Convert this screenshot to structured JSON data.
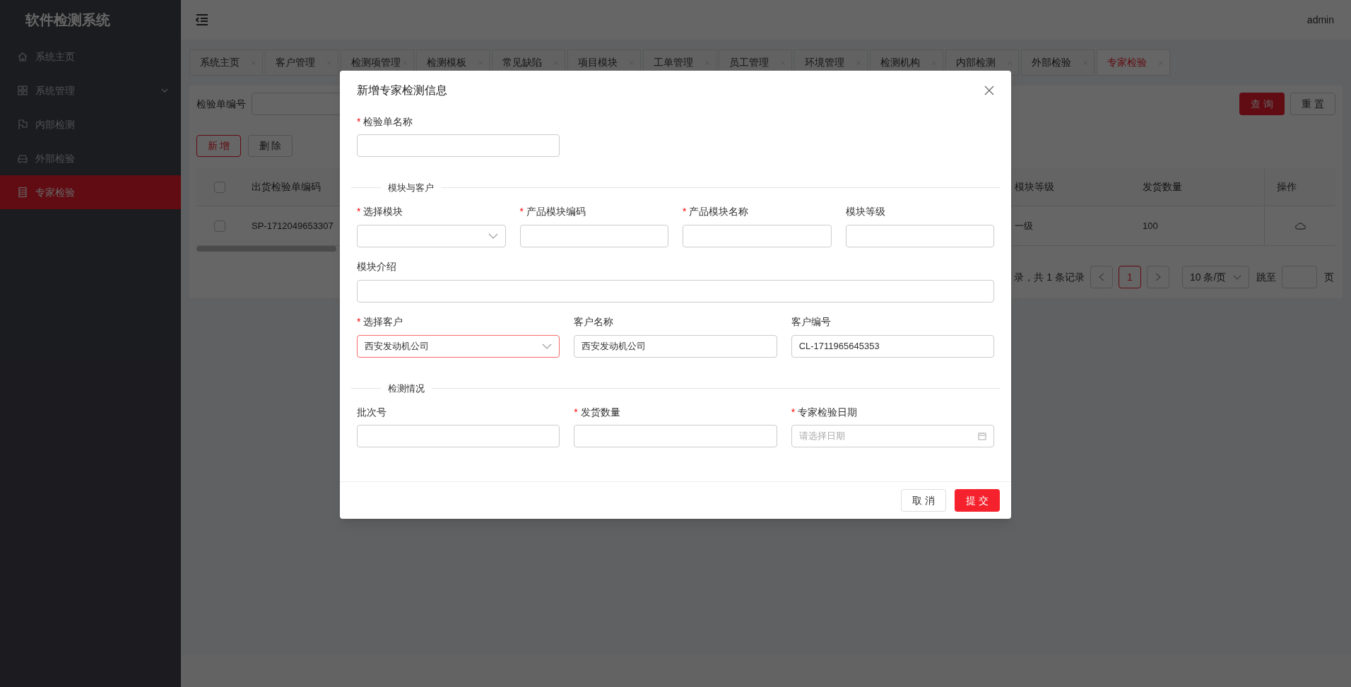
{
  "sidebar": {
    "title": "软件检测系统",
    "items": [
      {
        "label": "系统主页",
        "kind": "home",
        "selected": false,
        "expandable": false
      },
      {
        "label": "系统管理",
        "kind": "grid",
        "selected": false,
        "expandable": true
      },
      {
        "label": "内部检测",
        "kind": "flag",
        "selected": false,
        "expandable": false
      },
      {
        "label": "外部检验",
        "kind": "car",
        "selected": false,
        "expandable": false
      },
      {
        "label": "专家检验",
        "kind": "list",
        "selected": true,
        "expandable": false
      }
    ]
  },
  "header": {
    "user": "admin"
  },
  "tabs": [
    {
      "label": "系统主页",
      "selected": false
    },
    {
      "label": "客户管理",
      "selected": false
    },
    {
      "label": "检测项管理",
      "selected": false
    },
    {
      "label": "检测模板",
      "selected": false
    },
    {
      "label": "常见缺陷",
      "selected": false
    },
    {
      "label": "项目模块",
      "selected": false
    },
    {
      "label": "工单管理",
      "selected": false
    },
    {
      "label": "员工管理",
      "selected": false
    },
    {
      "label": "环境管理",
      "selected": false
    },
    {
      "label": "检测机构",
      "selected": false
    },
    {
      "label": "内部检测",
      "selected": false
    },
    {
      "label": "外部检验",
      "selected": false
    },
    {
      "label": "专家检验",
      "selected": true
    }
  ],
  "search": {
    "label": "检验单编号",
    "query_button": "查 询",
    "reset_button": "重 置"
  },
  "actions": [
    {
      "label": "新 增",
      "kind": "primary"
    },
    {
      "label": "删 除",
      "kind": "plain"
    }
  ],
  "table": {
    "header_checked": false,
    "columns": [
      "出货检验单编码",
      "模块等级",
      "发货数量",
      "操作"
    ],
    "rows": [
      {
        "checked": false,
        "cells": [
          "SP-1712049653307",
          "一级",
          "100"
        ]
      }
    ]
  },
  "pagination": {
    "summary": "录，共 1 条记录",
    "pages": [
      {
        "label": "1",
        "selected": true
      }
    ],
    "page_size": "10 条/页",
    "jump_label": "跳至",
    "page_suffix": "页"
  },
  "dialog": {
    "title": "新增专家检测信息",
    "sections": [
      {
        "rows": [
          {
            "fields": [
              {
                "label": "检验单名称",
                "required": true,
                "kind": "text"
              }
            ]
          }
        ]
      },
      {
        "heading": "模块与客户",
        "rows": [
          {
            "fields": [
              {
                "label": "选择模块",
                "required": true,
                "kind": "select"
              },
              {
                "label": "产品模块编码",
                "required": true,
                "kind": "text"
              },
              {
                "label": "产品模块名称",
                "required": true,
                "kind": "text"
              },
              {
                "label": "模块等级",
                "required": false,
                "kind": "text"
              }
            ]
          },
          {
            "fields": [
              {
                "label": "模块介绍",
                "required": false,
                "kind": "text"
              }
            ]
          },
          {
            "fields": [
              {
                "label": "选择客户",
                "required": true,
                "kind": "select",
                "value": "西安发动机公司",
                "focused": true
              },
              {
                "label": "客户名称",
                "required": false,
                "kind": "text",
                "value": "西安发动机公司"
              },
              {
                "label": "客户编号",
                "required": false,
                "kind": "text",
                "value": "CL-1711965645353"
              }
            ]
          }
        ]
      },
      {
        "heading": "检测情况",
        "rows": [
          {
            "fields": [
              {
                "label": "批次号",
                "required": false,
                "kind": "text"
              },
              {
                "label": "发货数量",
                "required": true,
                "kind": "text"
              },
              {
                "label": "专家检验日期",
                "required": true,
                "kind": "date",
                "placeholder": "请选择日期"
              }
            ]
          }
        ]
      }
    ],
    "required_mark": "*",
    "cancel_button": "取 消",
    "submit_button": "提 交"
  }
}
